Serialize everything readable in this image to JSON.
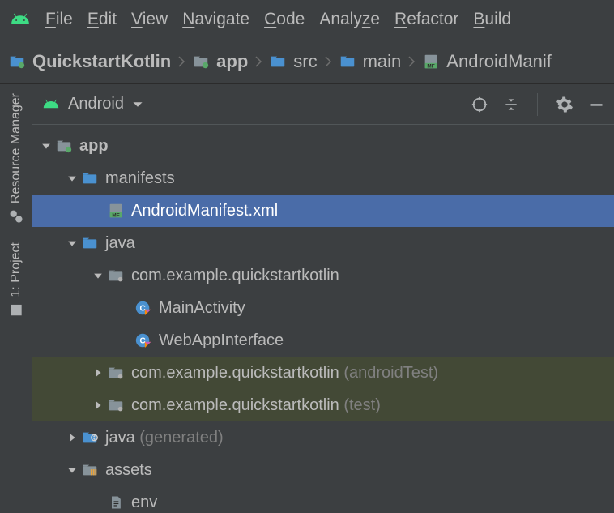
{
  "menu": {
    "items": [
      "File",
      "Edit",
      "View",
      "Navigate",
      "Code",
      "Analyze",
      "Refactor",
      "Build"
    ]
  },
  "breadcrumb": {
    "items": [
      {
        "label": "QuickstartKotlin",
        "icon": "project",
        "bold": true
      },
      {
        "label": "app",
        "icon": "module",
        "bold": true
      },
      {
        "label": "src",
        "icon": "folder",
        "bold": false
      },
      {
        "label": "main",
        "icon": "folder",
        "bold": false
      },
      {
        "label": "AndroidManif",
        "icon": "manifest",
        "bold": false
      }
    ]
  },
  "sidebar": {
    "items": [
      {
        "label": "Resource Manager",
        "icon": "resource"
      },
      {
        "label": "1: Project",
        "icon": "project-tool"
      }
    ]
  },
  "panel": {
    "view_label": "Android"
  },
  "tree": {
    "rows": [
      {
        "indent": 0,
        "arrow": "down",
        "icon": "module",
        "label": "app",
        "suffix": "",
        "selected": false,
        "test": false,
        "bold": true
      },
      {
        "indent": 1,
        "arrow": "down",
        "icon": "folder",
        "label": "manifests",
        "suffix": "",
        "selected": false,
        "test": false,
        "bold": false
      },
      {
        "indent": 2,
        "arrow": "",
        "icon": "manifest",
        "label": "AndroidManifest.xml",
        "suffix": "",
        "selected": true,
        "test": false,
        "bold": false
      },
      {
        "indent": 1,
        "arrow": "down",
        "icon": "folder",
        "label": "java",
        "suffix": "",
        "selected": false,
        "test": false,
        "bold": false
      },
      {
        "indent": 2,
        "arrow": "down",
        "icon": "package",
        "label": "com.example.quickstartkotlin",
        "suffix": "",
        "selected": false,
        "test": false,
        "bold": false
      },
      {
        "indent": 3,
        "arrow": "",
        "icon": "kotlin-class",
        "label": "MainActivity",
        "suffix": "",
        "selected": false,
        "test": false,
        "bold": false
      },
      {
        "indent": 3,
        "arrow": "",
        "icon": "kotlin-class",
        "label": "WebAppInterface",
        "suffix": "",
        "selected": false,
        "test": false,
        "bold": false
      },
      {
        "indent": 2,
        "arrow": "right",
        "icon": "package",
        "label": "com.example.quickstartkotlin",
        "suffix": " (androidTest)",
        "selected": false,
        "test": true,
        "bold": false
      },
      {
        "indent": 2,
        "arrow": "right",
        "icon": "package",
        "label": "com.example.quickstartkotlin",
        "suffix": " (test)",
        "selected": false,
        "test": true,
        "bold": false
      },
      {
        "indent": 1,
        "arrow": "right",
        "icon": "gen-folder",
        "label": "java",
        "suffix": " (generated)",
        "selected": false,
        "test": false,
        "bold": false
      },
      {
        "indent": 1,
        "arrow": "down",
        "icon": "assets-folder",
        "label": "assets",
        "suffix": "",
        "selected": false,
        "test": false,
        "bold": false
      },
      {
        "indent": 2,
        "arrow": "",
        "icon": "file",
        "label": "env",
        "suffix": "",
        "selected": false,
        "test": false,
        "bold": false
      }
    ]
  }
}
